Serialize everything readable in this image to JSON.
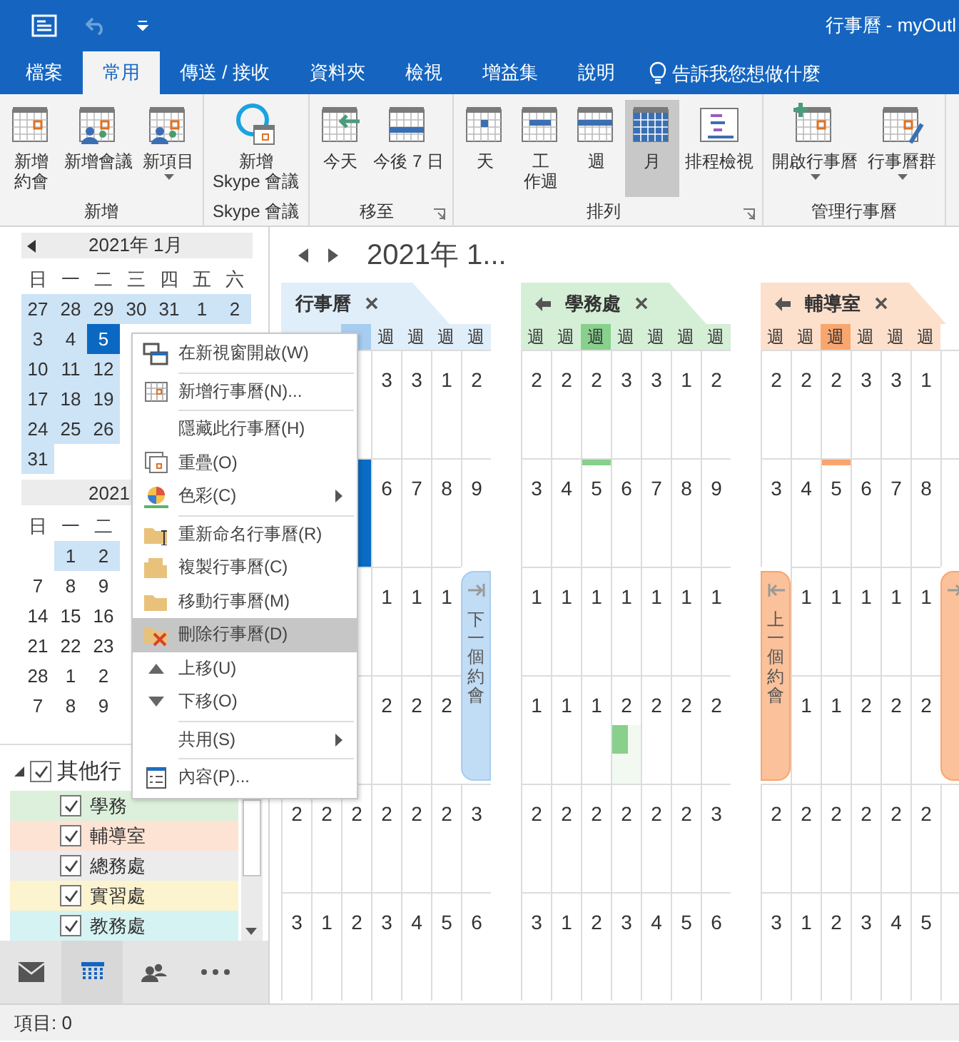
{
  "window": {
    "title": "行事曆 - myOutl"
  },
  "quick_access": [
    {
      "kind": "app"
    },
    {
      "kind": "undo"
    },
    {
      "kind": "customize"
    }
  ],
  "tabs": [
    {
      "label": "檔案",
      "selected": false
    },
    {
      "label": "常用",
      "selected": true
    },
    {
      "label": "傳送 / 接收",
      "selected": false
    },
    {
      "label": "資料夾",
      "selected": false
    },
    {
      "label": "檢視",
      "selected": false
    },
    {
      "label": "增益集",
      "selected": false
    },
    {
      "label": "說明",
      "selected": false
    }
  ],
  "tell_me": {
    "placeholder": "告訴我您想做什麼"
  },
  "ribbon": [
    {
      "label": "新增",
      "launcher": false,
      "buttons": [
        {
          "kind": "appointment",
          "lines": [
            "新增",
            "約會"
          ],
          "dropdown": false,
          "selected": false
        },
        {
          "kind": "meeting",
          "lines": [
            "新增會議"
          ],
          "dropdown": false,
          "selected": false
        },
        {
          "kind": "new-items",
          "lines": [
            "新項目"
          ],
          "dropdown": true,
          "selected": false
        }
      ]
    },
    {
      "label": "Skype 會議",
      "launcher": false,
      "buttons": [
        {
          "kind": "skype",
          "lines": [
            "新增",
            "Skype 會議"
          ],
          "dropdown": false,
          "selected": false
        }
      ]
    },
    {
      "label": "移至",
      "launcher": true,
      "buttons": [
        {
          "kind": "today",
          "lines": [
            "今天"
          ],
          "dropdown": false,
          "selected": false
        },
        {
          "kind": "next7",
          "lines": [
            "今後 7 日"
          ],
          "dropdown": false,
          "selected": false
        }
      ]
    },
    {
      "label": "排列",
      "launcher": true,
      "buttons": [
        {
          "kind": "day",
          "lines": [
            "天"
          ],
          "dropdown": false,
          "selected": false
        },
        {
          "kind": "workweek",
          "lines": [
            "工",
            "作週"
          ],
          "dropdown": false,
          "selected": false
        },
        {
          "kind": "week",
          "lines": [
            "週"
          ],
          "dropdown": false,
          "selected": false
        },
        {
          "kind": "month",
          "lines": [
            "月"
          ],
          "dropdown": false,
          "selected": true
        },
        {
          "kind": "schedule",
          "lines": [
            "排程檢視"
          ],
          "dropdown": false,
          "selected": false
        }
      ]
    },
    {
      "label": "管理行事曆",
      "launcher": false,
      "buttons": [
        {
          "kind": "open-calendar",
          "lines": [
            "開啟行事曆"
          ],
          "dropdown": true,
          "selected": false
        },
        {
          "kind": "calendar-groups",
          "lines": [
            "行事曆群"
          ],
          "dropdown": true,
          "selected": false
        }
      ]
    }
  ],
  "mini_calendars": [
    {
      "title": "2021年 1月",
      "weekdays": [
        "日",
        "一",
        "二",
        "三",
        "四",
        "五",
        "六"
      ],
      "rows": [
        [
          {
            "text": "27",
            "highlighted": true,
            "selected": false
          },
          {
            "text": "28",
            "highlighted": true,
            "selected": false
          },
          {
            "text": "29",
            "highlighted": true,
            "selected": false
          },
          {
            "text": "30",
            "highlighted": true,
            "selected": false
          },
          {
            "text": "31",
            "highlighted": true,
            "selected": false
          },
          {
            "text": "1",
            "highlighted": true,
            "selected": false
          },
          {
            "text": "2",
            "highlighted": true,
            "selected": false
          }
        ],
        [
          {
            "text": "3",
            "highlighted": true,
            "selected": false
          },
          {
            "text": "4",
            "highlighted": true,
            "selected": false
          },
          {
            "text": "5",
            "highlighted": true,
            "selected": true
          }
        ],
        [
          {
            "text": "10",
            "highlighted": true,
            "selected": false
          },
          {
            "text": "11",
            "highlighted": true,
            "selected": false
          },
          {
            "text": "12",
            "highlighted": true,
            "selected": false
          }
        ],
        [
          {
            "text": "17",
            "highlighted": true,
            "selected": false
          },
          {
            "text": "18",
            "highlighted": true,
            "selected": false
          },
          {
            "text": "19",
            "highlighted": true,
            "selected": false
          }
        ],
        [
          {
            "text": "24",
            "highlighted": true,
            "selected": false
          },
          {
            "text": "25",
            "highlighted": true,
            "selected": false
          },
          {
            "text": "26",
            "highlighted": true,
            "selected": false
          }
        ],
        [
          {
            "text": "31",
            "highlighted": true,
            "selected": false
          }
        ]
      ]
    },
    {
      "title": "2021",
      "weekdays": [
        "日",
        "一",
        "二"
      ],
      "rows": [
        [
          null,
          {
            "text": "1",
            "highlighted": true,
            "selected": false
          },
          {
            "text": "2",
            "highlighted": true,
            "selected": false
          }
        ],
        [
          {
            "text": "7",
            "highlighted": false,
            "selected": false
          },
          {
            "text": "8",
            "highlighted": false,
            "selected": false
          },
          {
            "text": "9",
            "highlighted": false,
            "selected": false
          }
        ],
        [
          {
            "text": "14",
            "highlighted": false,
            "selected": false
          },
          {
            "text": "15",
            "highlighted": false,
            "selected": false
          },
          {
            "text": "16",
            "highlighted": false,
            "selected": false
          }
        ],
        [
          {
            "text": "21",
            "highlighted": false,
            "selected": false
          },
          {
            "text": "22",
            "highlighted": false,
            "selected": false
          },
          {
            "text": "23",
            "highlighted": false,
            "selected": false
          }
        ],
        [
          {
            "text": "28",
            "highlighted": false,
            "selected": false
          },
          {
            "text": "1",
            "highlighted": false,
            "selected": false
          },
          {
            "text": "2",
            "highlighted": false,
            "selected": false
          }
        ],
        [
          {
            "text": "7",
            "highlighted": false,
            "selected": false
          },
          {
            "text": "8",
            "highlighted": false,
            "selected": false
          },
          {
            "text": "9",
            "highlighted": false,
            "selected": false
          }
        ]
      ]
    }
  ],
  "calendar_group": {
    "label": "其他行",
    "expanded": true,
    "checked": true,
    "items": [
      {
        "name": "學務",
        "checked": true,
        "color": "#dcf0dc"
      },
      {
        "name": "輔導室",
        "checked": true,
        "color": "#fde3d4"
      },
      {
        "name": "總務處",
        "checked": true,
        "color": "#ececec"
      },
      {
        "name": "實習處",
        "checked": true,
        "color": "#fcf3cf"
      },
      {
        "name": "教務處",
        "checked": true,
        "color": "#d5f3f2"
      }
    ]
  },
  "nav": [
    {
      "kind": "mail",
      "selected": false
    },
    {
      "kind": "calendar",
      "selected": true
    },
    {
      "kind": "people",
      "selected": false
    },
    {
      "kind": "more",
      "selected": false
    }
  ],
  "heading": "2021年 1...",
  "panes": [
    {
      "title": "行事曆",
      "back_arrow": false,
      "color": "#a6cdf0",
      "header": [
        {
          "selected": false
        },
        {
          "selected": false
        },
        {
          "selected": true
        },
        {
          "text": "週",
          "selected": false
        },
        {
          "text": "週",
          "selected": false
        },
        {
          "text": "週",
          "selected": false
        },
        {
          "text": "週",
          "selected": false
        }
      ],
      "rows": [
        [
          null,
          null,
          null,
          "3",
          "3",
          "1",
          "2"
        ],
        [
          null,
          null,
          {
            "kind": "today"
          },
          "6",
          "7",
          "8",
          "9"
        ],
        [
          null,
          null,
          null,
          "1",
          "1",
          "1",
          null
        ],
        [
          null,
          null,
          null,
          "2",
          "2",
          "2",
          null
        ],
        [
          "2",
          "2",
          "2",
          "2",
          "2",
          "2",
          "3"
        ],
        [
          "3",
          "1",
          "2",
          "3",
          "4",
          "5",
          "6"
        ]
      ],
      "side_tabs": [
        {
          "kind": "next",
          "text": "下一個約會"
        }
      ]
    },
    {
      "title": "學務處",
      "back_arrow": true,
      "color": "#88d08c",
      "header": [
        {
          "text": "週",
          "selected": false
        },
        {
          "text": "週",
          "selected": false
        },
        {
          "text": "週",
          "selected": true
        },
        {
          "text": "週",
          "selected": false
        },
        {
          "text": "週",
          "selected": false
        },
        {
          "text": "週",
          "selected": false
        },
        {
          "text": "週",
          "selected": false
        }
      ],
      "rows": [
        [
          "2",
          "2",
          "2",
          "3",
          "3",
          "1",
          "2"
        ],
        [
          "3",
          "4",
          {
            "text": "5",
            "kind": "today-bar"
          },
          "6",
          "7",
          "8",
          "9"
        ],
        [
          "1",
          "1",
          "1",
          "1",
          "1",
          "1",
          "1"
        ],
        [
          "1",
          "1",
          "1",
          {
            "text": "2",
            "kind": "event"
          },
          "2",
          "2",
          "2"
        ],
        [
          "2",
          "2",
          "2",
          "2",
          "2",
          "2",
          "3"
        ],
        [
          "3",
          "1",
          "2",
          "3",
          "4",
          "5",
          "6"
        ]
      ]
    },
    {
      "title": "輔導室",
      "back_arrow": true,
      "color": "#f9a66e",
      "header": [
        {
          "text": "週",
          "selected": false
        },
        {
          "text": "週",
          "selected": false
        },
        {
          "text": "週",
          "selected": true
        },
        {
          "text": "週",
          "selected": false
        },
        {
          "text": "週",
          "selected": false
        },
        {
          "text": "週",
          "selected": false
        }
      ],
      "rows": [
        [
          "2",
          "2",
          "2",
          "3",
          "3",
          "1",
          null
        ],
        [
          "3",
          "4",
          {
            "text": "5",
            "kind": "today-bar"
          },
          "6",
          "7",
          "8",
          null
        ],
        [
          null,
          "1",
          "1",
          "1",
          "1",
          "1",
          null
        ],
        [
          null,
          "1",
          "1",
          "2",
          "2",
          "2",
          null
        ],
        [
          "2",
          "2",
          "2",
          "2",
          "2",
          "2",
          null
        ],
        [
          "3",
          "1",
          "2",
          "3",
          "4",
          "5",
          null
        ]
      ],
      "side_tabs": [
        {
          "kind": "prev",
          "text": "上一個約會"
        },
        {
          "kind": "next"
        }
      ]
    }
  ],
  "context_menu": [
    {
      "kind": "open-window",
      "text": "在新視窗開啟(W)",
      "selected": false,
      "submenu": false
    },
    {
      "kind": "separator"
    },
    {
      "kind": "new-calendar",
      "text": "新增行事曆(N)...",
      "selected": false,
      "submenu": false
    },
    {
      "kind": "separator"
    },
    {
      "kind": "plain",
      "text": "隱藏此行事曆(H)",
      "selected": false,
      "submenu": false
    },
    {
      "kind": "overlay",
      "text": "重疊(O)",
      "selected": false,
      "submenu": false
    },
    {
      "kind": "color",
      "text": "色彩(C)",
      "selected": false,
      "submenu": true
    },
    {
      "kind": "separator"
    },
    {
      "kind": "rename",
      "text": "重新命名行事曆(R)",
      "selected": false,
      "submenu": false
    },
    {
      "kind": "copy",
      "text": "複製行事曆(C)",
      "selected": false,
      "submenu": false
    },
    {
      "kind": "move",
      "text": "移動行事曆(M)",
      "selected": false,
      "submenu": false
    },
    {
      "kind": "delete",
      "text": "刪除行事曆(D)",
      "selected": true,
      "submenu": false
    },
    {
      "kind": "up",
      "text": "上移(U)",
      "selected": false,
      "submenu": false
    },
    {
      "kind": "down",
      "text": "下移(O)",
      "selected": false,
      "submenu": false
    },
    {
      "kind": "separator"
    },
    {
      "kind": "plain",
      "text": "共用(S)",
      "selected": false,
      "submenu": true
    },
    {
      "kind": "separator"
    },
    {
      "kind": "properties",
      "text": "內容(P)...",
      "selected": false,
      "submenu": false
    }
  ],
  "status_bar": "項目: 0"
}
